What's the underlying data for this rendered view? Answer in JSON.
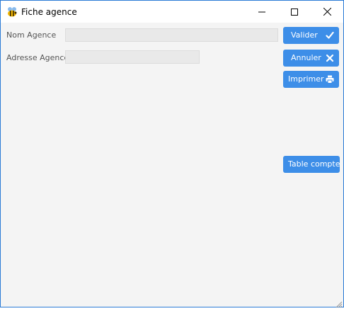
{
  "window": {
    "title": "Fiche agence",
    "icon": "bee-app-icon",
    "controls": [
      "minimize-icon",
      "maximize-icon",
      "close-icon"
    ]
  },
  "form": {
    "nom_label": "Nom Agence",
    "nom_value": "",
    "adresse_label": "Adresse Agence",
    "adresse_value": ""
  },
  "actions": {
    "valider_label": "Valider",
    "annuler_label": "Annuler",
    "imprimer_label": "Imprimer",
    "table_compte_label": "Table compte"
  },
  "colors": {
    "accent": "#3d8ee8",
    "window_border": "#2b7bd6",
    "background": "#f4f4f4"
  }
}
